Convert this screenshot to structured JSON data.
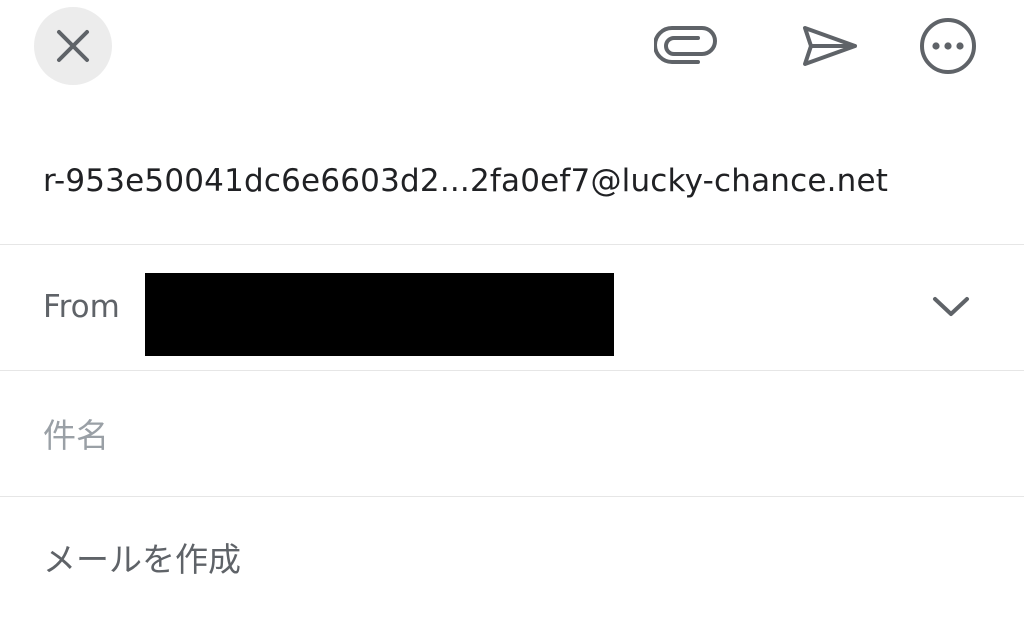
{
  "toolbar": {
    "close_icon": "close-icon",
    "attach_icon": "paperclip-icon",
    "send_icon": "send-icon",
    "more_icon": "more-options-icon"
  },
  "compose": {
    "to_address": "r-953e50041dc6e6603d2...2fa0ef7@lucky-chance.net",
    "from_label": "From",
    "subject_placeholder": "件名",
    "body_placeholder": "メールを作成"
  },
  "colors": {
    "background": "#ffffff",
    "close_button_bg": "#ececec",
    "icon": "#5f6368",
    "divider": "#e6e6e6",
    "redaction": "#000000"
  }
}
